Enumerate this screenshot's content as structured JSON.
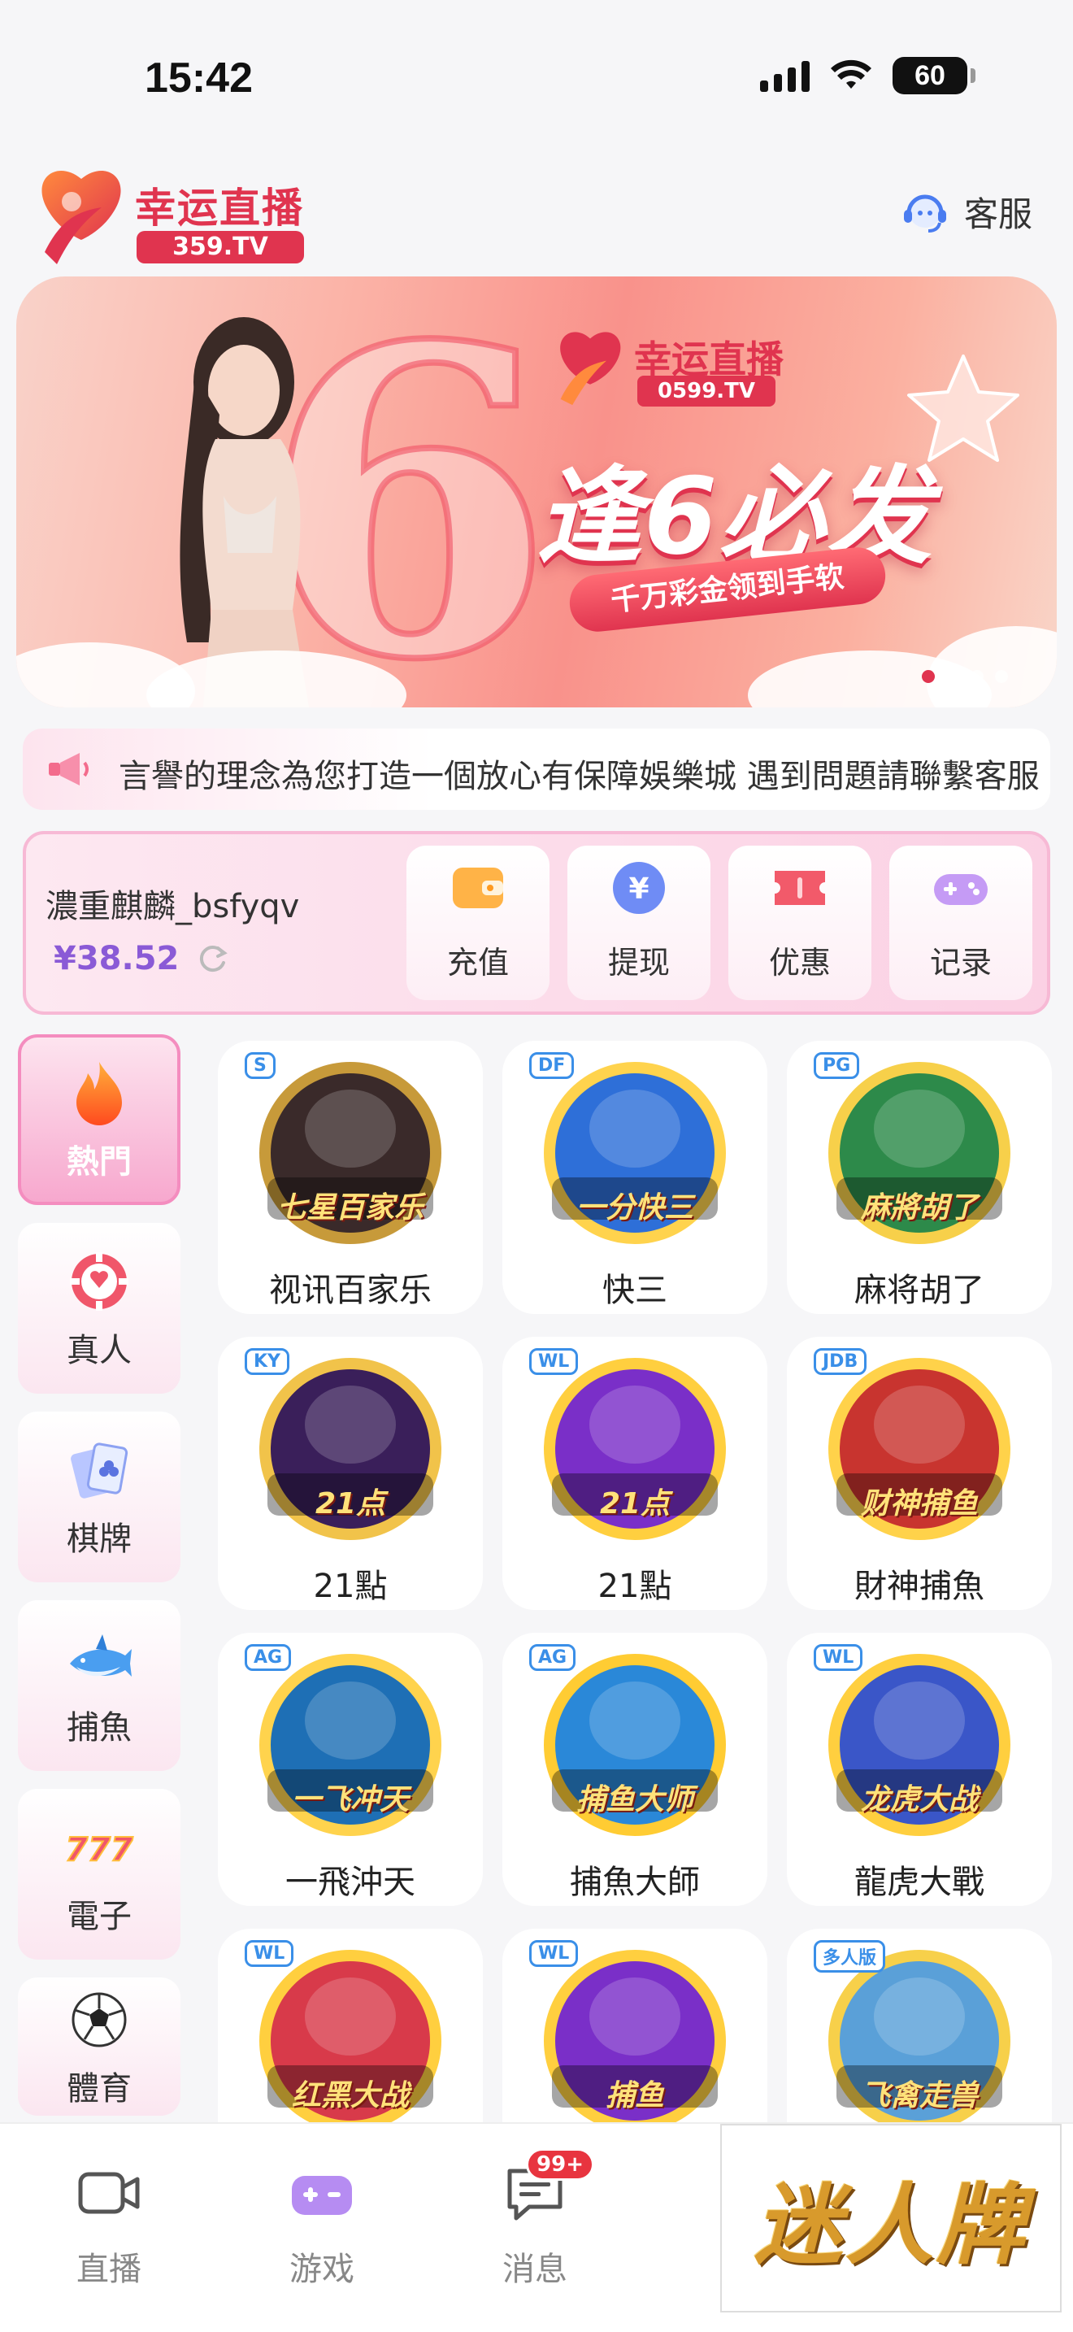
{
  "status_bar": {
    "time": "15:42",
    "battery": "60"
  },
  "header": {
    "logo_title": "幸运直播",
    "logo_sub": "359.TV",
    "service_label": "客服"
  },
  "banner": {
    "logo_title": "幸运直播",
    "logo_sub": "0599.TV",
    "headline": "逢6必发",
    "pill": "千万彩金领到手软",
    "slide_count": 4,
    "active_slide": 1
  },
  "marquee": {
    "text": "言譽的理念為您打造一個放心有保障娛樂城  遇到問題請聯繫客服"
  },
  "wallet": {
    "username": "濃重麒麟_bsfyqv",
    "balance": "¥38.52",
    "actions": [
      {
        "label": "充值",
        "icon": "wallet-icon"
      },
      {
        "label": "提现",
        "icon": "yen-coin-icon"
      },
      {
        "label": "优惠",
        "icon": "ticket-icon"
      },
      {
        "label": "记录",
        "icon": "gamepad-icon"
      }
    ]
  },
  "categories": [
    {
      "label": "熱門",
      "icon": "flame-icon",
      "active": true
    },
    {
      "label": "真人",
      "icon": "poker-chip-icon"
    },
    {
      "label": "棋牌",
      "icon": "playing-cards-icon"
    },
    {
      "label": "捕魚",
      "icon": "shark-icon"
    },
    {
      "label": "電子",
      "icon": "slot-777-icon"
    },
    {
      "label": "體育",
      "icon": "soccer-ball-icon"
    }
  ],
  "games": [
    {
      "label": "视讯百家乐",
      "art_text": "七星百家乐",
      "badge": "S"
    },
    {
      "label": "快三",
      "art_text": "一分快三",
      "badge": "DF"
    },
    {
      "label": "麻将胡了",
      "art_text": "麻將胡了",
      "badge": "PG"
    },
    {
      "label": "21點",
      "art_text": "21点",
      "badge": "KY"
    },
    {
      "label": "21點",
      "art_text": "21点",
      "badge": "WL"
    },
    {
      "label": "財神捕魚",
      "art_text": "财神捕鱼",
      "badge": "JDB"
    },
    {
      "label": "一飛沖天",
      "art_text": "一飞冲天",
      "badge": "AG"
    },
    {
      "label": "捕魚大師",
      "art_text": "捕鱼大师",
      "badge": "AG"
    },
    {
      "label": "龍虎大戰",
      "art_text": "龙虎大战",
      "badge": "WL"
    },
    {
      "label": "",
      "art_text": "红黑大战",
      "badge": "WL"
    },
    {
      "label": "",
      "art_text": "捕鱼",
      "badge": "WL"
    },
    {
      "label": "",
      "art_text": "飞禽走兽",
      "badge": "多人版"
    }
  ],
  "bottom_nav": [
    {
      "label": "直播",
      "icon": "video-camera-icon"
    },
    {
      "label": "游戏",
      "icon": "gamepad-icon",
      "active": true
    },
    {
      "label": "消息",
      "icon": "chat-bubble-icon",
      "badge": "99+"
    }
  ],
  "promo": {
    "text": "迷人牌"
  },
  "colors": {
    "brand": "#e0344f",
    "accent": "#8a5ad6",
    "pink": "#f48dbf"
  }
}
